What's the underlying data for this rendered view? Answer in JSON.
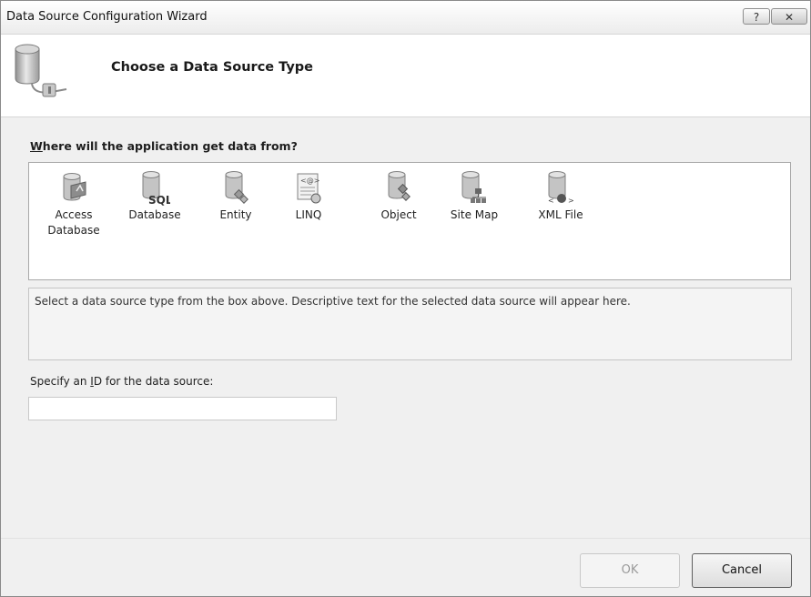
{
  "window": {
    "title": "Data Source Configuration Wizard",
    "help_glyph": "?",
    "close_glyph": "✕"
  },
  "header": {
    "title": "Choose a Data Source Type",
    "icon": "database-plug-icon"
  },
  "source_prompt": {
    "mnemonic": "W",
    "rest": "here will the application get data from?"
  },
  "sources": [
    {
      "label": "Access",
      "label2": "Database",
      "icon": "access-database-icon"
    },
    {
      "label": "Database",
      "label2": "",
      "icon": "sql-database-icon"
    },
    {
      "label": "Entity",
      "label2": "",
      "icon": "entity-icon"
    },
    {
      "label": "LINQ",
      "label2": "",
      "icon": "linq-icon"
    },
    {
      "label": "Object",
      "label2": "",
      "icon": "object-icon"
    },
    {
      "label": "Site Map",
      "label2": "",
      "icon": "site-map-icon"
    },
    {
      "label": "XML File",
      "label2": "",
      "icon": "xml-file-icon"
    }
  ],
  "description": {
    "text": "Select a data source type from the box above. Descriptive text for the selected data source will appear here."
  },
  "id_field": {
    "label_before": "Specify an ",
    "label_mnemonic": "I",
    "label_after": "D for the data source:",
    "value": "",
    "placeholder": ""
  },
  "buttons": {
    "ok": "OK",
    "cancel": "Cancel"
  },
  "colors": {
    "dialog_bg": "#f0f0f0",
    "icon_gray": "#9a9a9a"
  }
}
